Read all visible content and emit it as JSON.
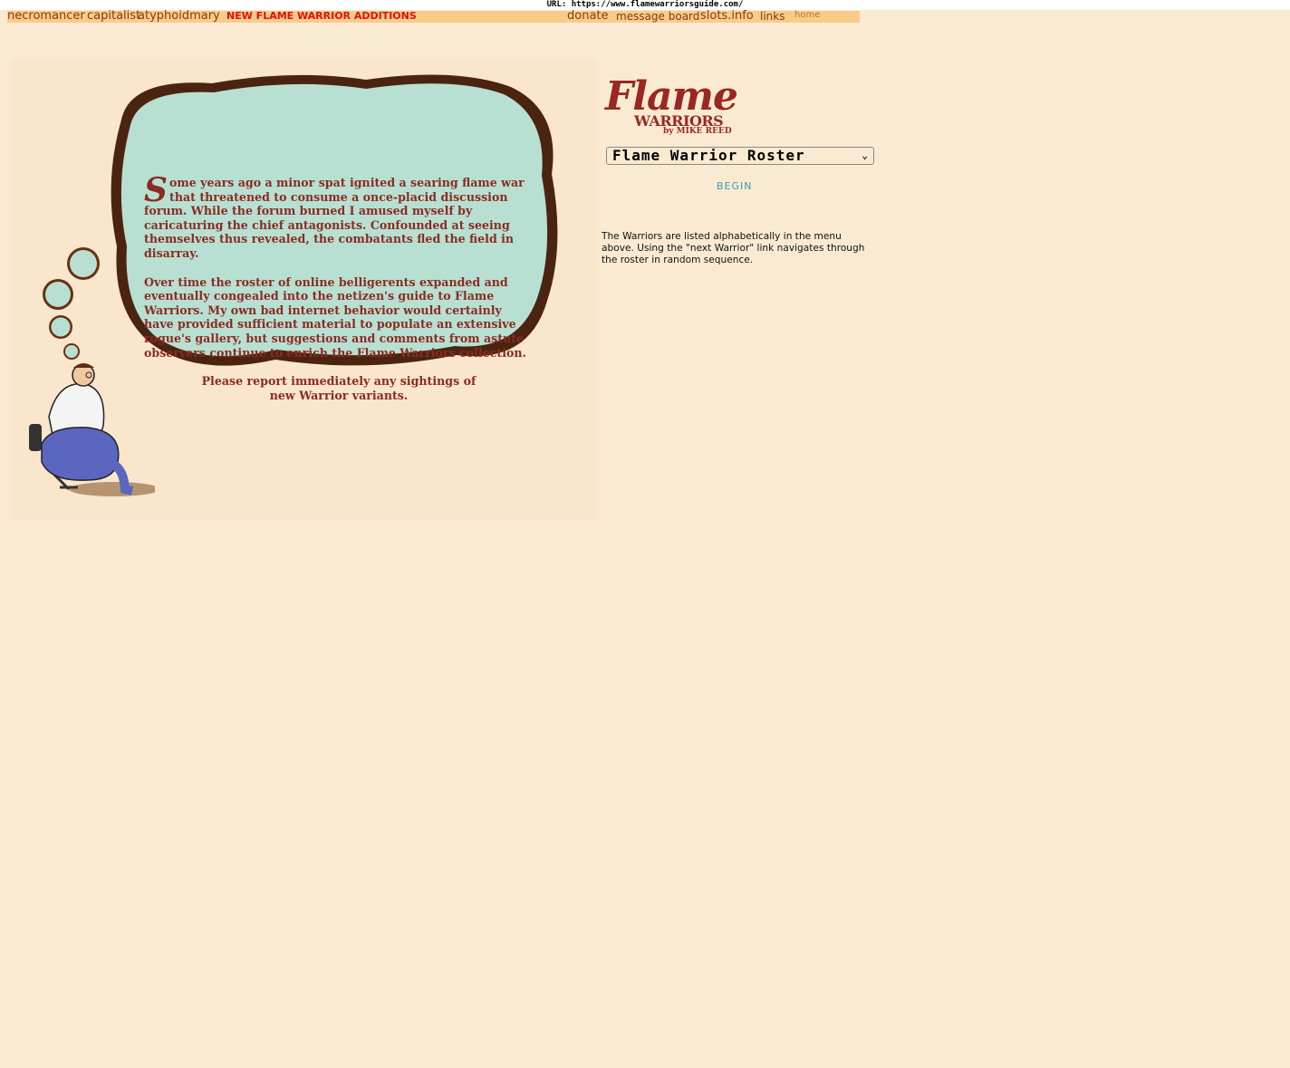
{
  "url_bar": {
    "label": "URL:",
    "url": "https://www.flamewarriorsguide.com/"
  },
  "topnav": {
    "item1": "necromancer",
    "item2": "capitalist",
    "item3": "atyphoidmary",
    "new_additions": "NEW FLAME WARRIOR ADDITIONS",
    "donate": "donate",
    "message_board": "message board",
    "slots": "slots.info",
    "links": "links",
    "home": "home"
  },
  "thought_bubble": {
    "dropcap": "S",
    "para1": "ome years ago a minor spat ignited a searing flame war that threatened to consume a once-placid discussion forum. While the forum burned I amused myself by caricaturing the chief antagonists. Confounded at seeing themselves thus revealed, the combatants fled the field in disarray.",
    "para2": "Over time the roster of online belligerents expanded and eventually congealed into the netizen's guide to Flame Warriors. My own bad internet behavior would certainly have provided sufficient material to populate an extensive rogue's gallery, but suggestions and comments from astute observers continue to enrich the Flame Warriors collection.",
    "para3": "Please report immediately any sightings of new Warrior variants."
  },
  "logo": {
    "title": "Flame",
    "subtitle": "WARRIORS",
    "byline": "by MIKE REED"
  },
  "roster_select": {
    "value": "Flame Warrior Roster"
  },
  "begin_link": "BEGIN",
  "description": "The Warriors are listed alphabetically in the menu above. Using the \"next Warrior\" link navigates through the roster in random sequence.",
  "colors": {
    "page_bg": "#fbead2",
    "nav_bg": "#f7cc8a",
    "bubble": "#b8e0d2",
    "text_red": "#8b2b22",
    "nav_red": "#e11010"
  }
}
